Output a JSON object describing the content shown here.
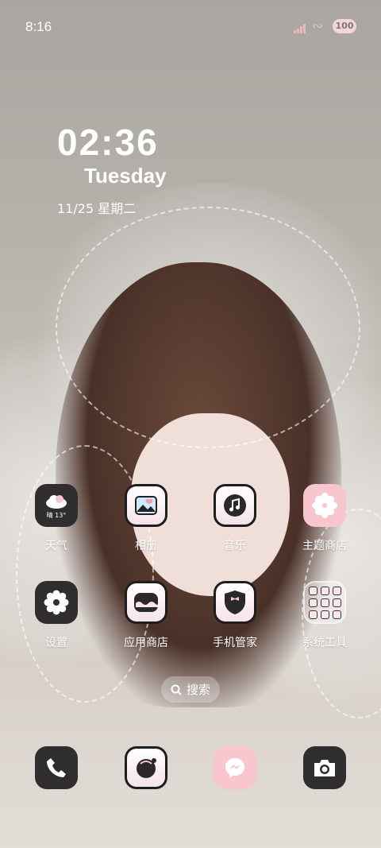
{
  "status_bar": {
    "time": "8:16",
    "battery": "100"
  },
  "widget": {
    "time": "02:36",
    "weekday": "Tuesday",
    "date": "11/25  星期二"
  },
  "weather": {
    "temp": "晴 13°"
  },
  "apps": [
    {
      "label": "天气",
      "icon": "weather-icon"
    },
    {
      "label": "相册",
      "icon": "gallery-icon"
    },
    {
      "label": "音乐",
      "icon": "music-icon"
    },
    {
      "label": "主题商店",
      "icon": "theme-store-icon"
    },
    {
      "label": "设置",
      "icon": "gear-icon"
    },
    {
      "label": "应用商店",
      "icon": "app-store-icon"
    },
    {
      "label": "手机管家",
      "icon": "phone-manager-icon"
    },
    {
      "label": "系统工具",
      "icon": "folder-icon"
    }
  ],
  "search": {
    "label": "搜索"
  },
  "dock": [
    {
      "icon": "phone-icon"
    },
    {
      "icon": "browser-icon"
    },
    {
      "icon": "messages-icon"
    },
    {
      "icon": "camera-icon"
    }
  ],
  "colors": {
    "accent_pink": "#f7c6cf",
    "icon_dark": "#2f2d2e"
  }
}
